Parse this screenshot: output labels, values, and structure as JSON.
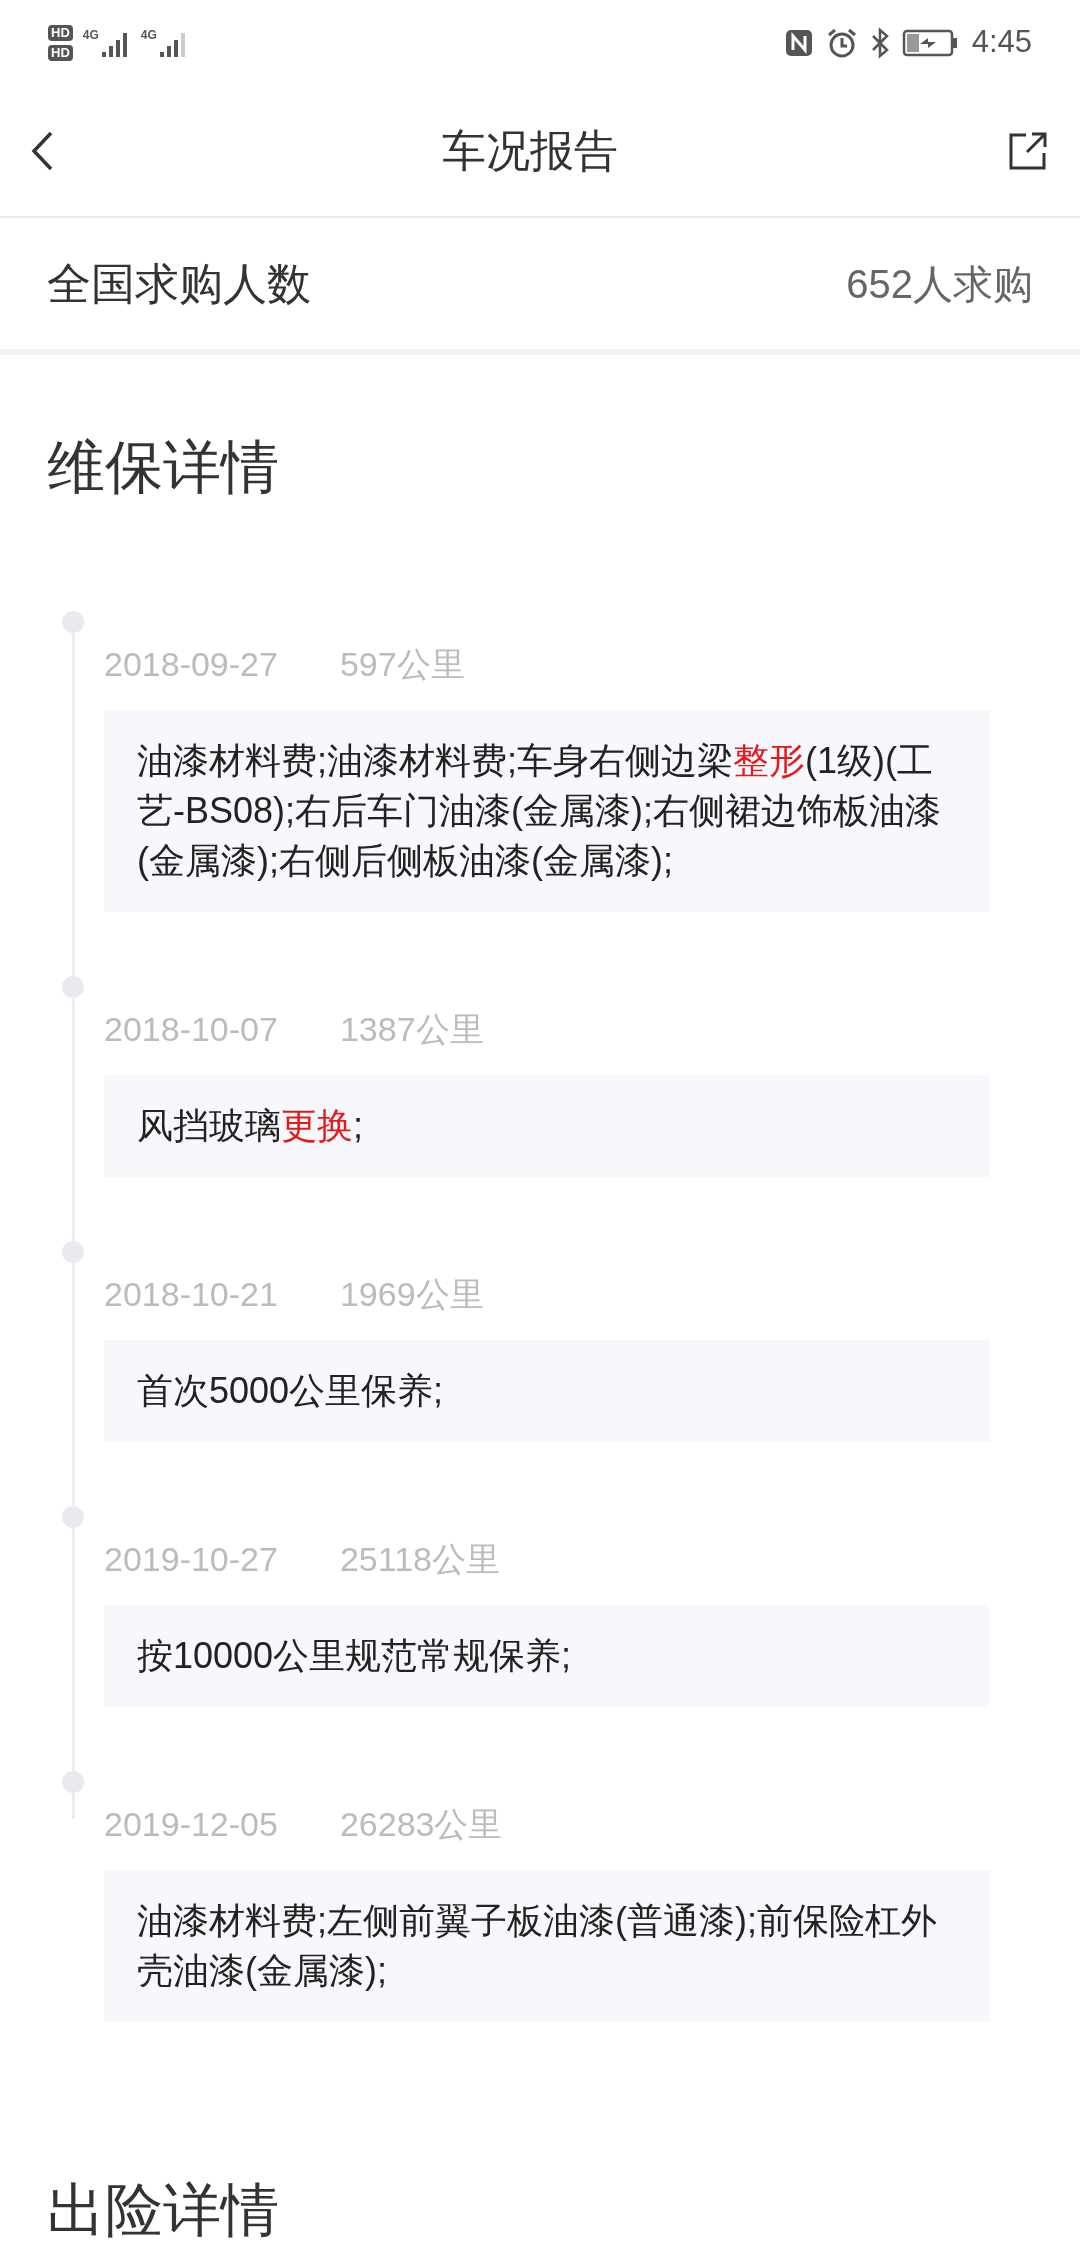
{
  "status_bar": {
    "sim_labels": [
      "HD",
      "HD"
    ],
    "network_labels": [
      "4G",
      "4G"
    ],
    "time": "4:45"
  },
  "header": {
    "title": "车况报告"
  },
  "buyers": {
    "label": "全国求购人数",
    "value": "652人求购"
  },
  "maintenance": {
    "title": "维保详情",
    "records": [
      {
        "date": "2018-09-27",
        "mileage": "597公里",
        "segments": [
          {
            "text": "油漆材料费;油漆材料费;车身右侧边梁",
            "highlight": false
          },
          {
            "text": "整形",
            "highlight": true
          },
          {
            "text": "(1级)(工艺-BS08);右后车门油漆(金属漆);右侧裙边饰板油漆(金属漆);右侧后侧板油漆(金属漆);",
            "highlight": false
          }
        ]
      },
      {
        "date": "2018-10-07",
        "mileage": "1387公里",
        "segments": [
          {
            "text": "风挡玻璃",
            "highlight": false
          },
          {
            "text": "更换",
            "highlight": true
          },
          {
            "text": ";",
            "highlight": false
          }
        ]
      },
      {
        "date": "2018-10-21",
        "mileage": "1969公里",
        "segments": [
          {
            "text": "首次5000公里保养;",
            "highlight": false
          }
        ]
      },
      {
        "date": "2019-10-27",
        "mileage": "25118公里",
        "segments": [
          {
            "text": "按10000公里规范常规保养;",
            "highlight": false
          }
        ]
      },
      {
        "date": "2019-12-05",
        "mileage": "26283公里",
        "segments": [
          {
            "text": "油漆材料费;左侧前翼子板油漆(普通漆);前保险杠外壳油漆(金属漆);",
            "highlight": false
          }
        ]
      }
    ]
  },
  "insurance": {
    "title": "出险详情"
  }
}
